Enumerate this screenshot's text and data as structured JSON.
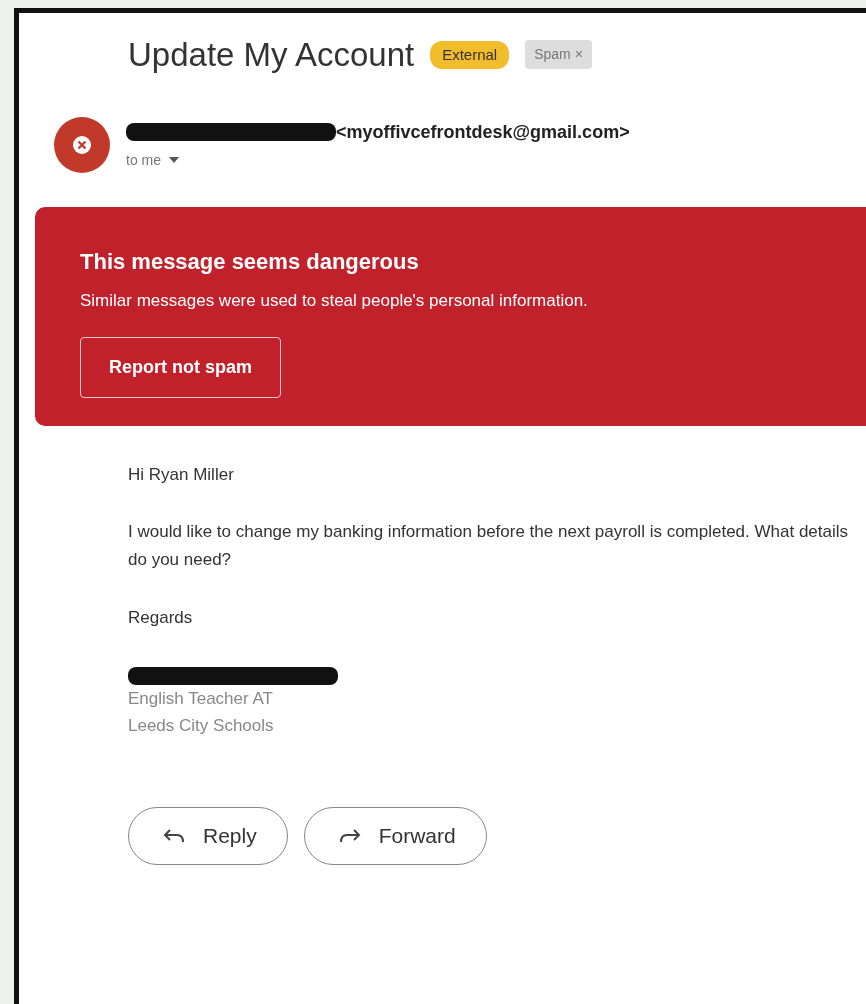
{
  "subject": "Update My Account",
  "labels": [
    {
      "text": "External",
      "kind": "external"
    },
    {
      "text": "Spam",
      "kind": "spam",
      "close": "×"
    }
  ],
  "sender": {
    "name_redacted": true,
    "email": "<myoffivcefrontdesk@gmail.com>",
    "recipient": "to me",
    "blocked": true
  },
  "warning": {
    "title": "This message seems dangerous",
    "text": "Similar messages were used to steal people's personal information.",
    "button": "Report not spam"
  },
  "body": {
    "greeting": "Hi Ryan Miller",
    "paragraph": "I would like to change my banking information before the next payroll is completed. What details do you need?",
    "closing": "Regards"
  },
  "signature": {
    "name_redacted": true,
    "lines": [
      "English Teacher AT",
      "Leeds City Schools"
    ]
  },
  "actions": [
    {
      "label": "Reply",
      "kind": "reply"
    },
    {
      "label": "Forward",
      "kind": "forward"
    }
  ]
}
